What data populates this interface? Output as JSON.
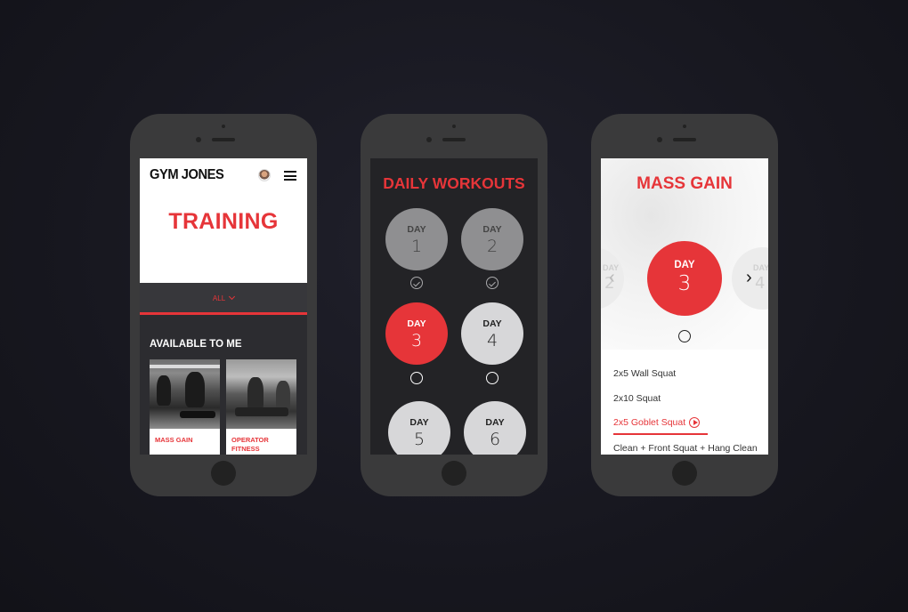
{
  "phone1": {
    "logo": "GYM JONES",
    "title": "TRAINING",
    "filter_label": "ALL",
    "section_title": "AVAILABLE TO ME",
    "cards": [
      {
        "label_line1": "MASS GAIN",
        "label_line2": ""
      },
      {
        "label_line1": "OPERATOR",
        "label_line2": "FITNESS"
      }
    ]
  },
  "phone2": {
    "title": "DAILY WORKOUTS",
    "day_word": "DAY",
    "days": [
      {
        "number": "1",
        "state": "done"
      },
      {
        "number": "2",
        "state": "done"
      },
      {
        "number": "3",
        "state": "active"
      },
      {
        "number": "4",
        "state": "todo"
      },
      {
        "number": "5",
        "state": "todo"
      },
      {
        "number": "6",
        "state": "todo"
      }
    ]
  },
  "phone3": {
    "title": "MASS GAIN",
    "day_word": "DAY",
    "current_day": "3",
    "prev_day": "2",
    "next_day": "4",
    "exercises": [
      "2x5 Wall Squat",
      "2x10 Squat",
      "2x5 Goblet Squat",
      "Clean + Front Squat + Hang Clean"
    ]
  },
  "colors": {
    "accent": "#e63539",
    "background": "#17171f",
    "device": "#3a3a3b"
  },
  "icons": [
    "avatar",
    "hamburger-menu-icon",
    "chevron-down-icon",
    "check-circle-icon",
    "empty-circle-icon",
    "chevron-left-icon",
    "chevron-right-icon",
    "play-circle-icon"
  ]
}
